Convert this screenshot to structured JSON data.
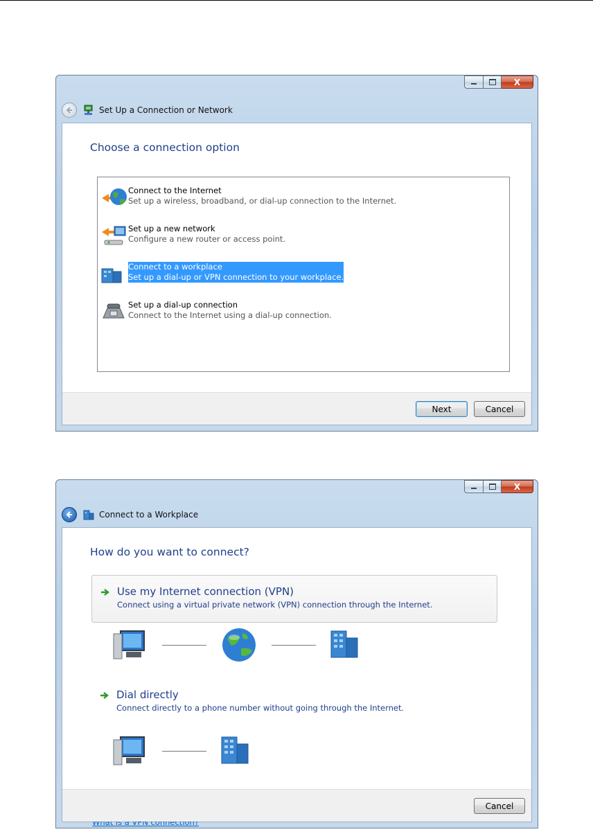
{
  "window1": {
    "title": "Set Up a Connection or Network",
    "heading": "Choose a connection option",
    "options": [
      {
        "title": "Connect to the Internet",
        "desc": "Set up a wireless, broadband, or dial-up connection to the Internet.",
        "icon": "globe-icon",
        "selected": false
      },
      {
        "title": "Set up a new network",
        "desc": "Configure a new router or access point.",
        "icon": "router-icon",
        "selected": false
      },
      {
        "title": "Connect to a workplace",
        "desc": "Set up a dial-up or VPN connection to your workplace.",
        "icon": "workplace-icon",
        "selected": true
      },
      {
        "title": "Set up a dial-up connection",
        "desc": "Connect to the Internet using a dial-up connection.",
        "icon": "phone-icon",
        "selected": false
      }
    ],
    "next_label": "Next",
    "cancel_label": "Cancel"
  },
  "window2": {
    "title": "Connect to a Workplace",
    "heading": "How do you want to connect?",
    "vpn": {
      "title": "Use my Internet connection (VPN)",
      "desc": "Connect using a virtual private network (VPN) connection through the Internet."
    },
    "dial": {
      "title": "Dial directly",
      "desc": "Connect directly to a phone number without going through the Internet."
    },
    "help_link": "What is a VPN connection?",
    "cancel_label": "Cancel"
  },
  "caption_buttons": {
    "close_glyph": "X"
  },
  "colors": {
    "heading": "#1e3f8a",
    "selection": "#3399ff",
    "link": "#0066cc",
    "arrow": "#2a9d2a"
  }
}
